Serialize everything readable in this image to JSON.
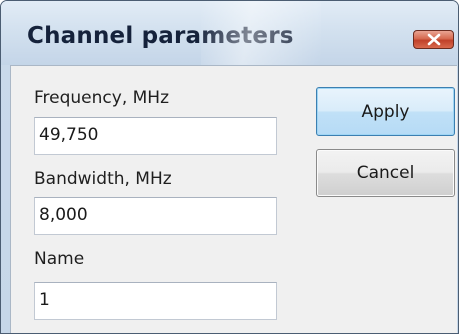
{
  "dialog": {
    "title": "Channel parameters"
  },
  "fields": {
    "frequency": {
      "label": "Frequency, MHz",
      "value": "49,750"
    },
    "bandwidth": {
      "label": "Bandwidth, MHz",
      "value": "8,000"
    },
    "name": {
      "label": "Name",
      "value": "1"
    }
  },
  "buttons": {
    "apply_label": "Apply",
    "cancel_label": "Cancel"
  },
  "icons": {
    "close": "close-icon"
  },
  "colors": {
    "close_button": "#c94a32",
    "apply_border": "#3c7fb1",
    "client_bg": "#f0f0f0"
  }
}
